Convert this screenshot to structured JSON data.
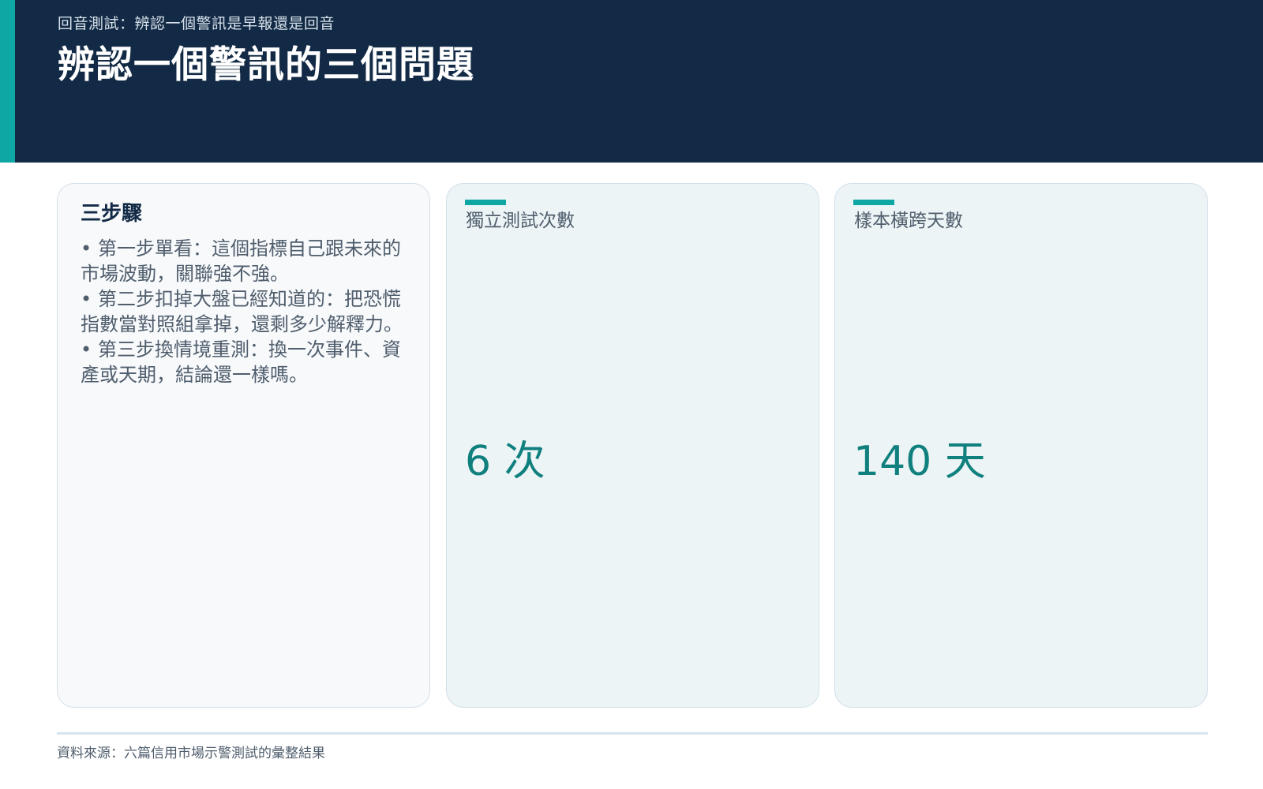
{
  "header": {
    "kicker": "回音測試：辨認一個警訊是早報還是回音",
    "title": "辨認一個警訊的三個問題"
  },
  "steps_card": {
    "title": "三步驟",
    "items": [
      "第一步單看：這個指標自己跟未來的市場波動，關聯強不強。",
      "第二步扣掉大盤已經知道的：把恐慌指數當對照組拿掉，還剩多少解釋力。",
      "第三步換情境重測：換一次事件、資產或天期，結論還一樣嗎。"
    ]
  },
  "metrics": [
    {
      "label": "獨立測試次數",
      "value": "6 次"
    },
    {
      "label": "樣本橫跨天數",
      "value": "140 天"
    }
  ],
  "footer": {
    "source": "資料來源：六篇信用市場示警測試的彙整結果"
  },
  "colors": {
    "header_bg": "#122a45",
    "accent": "#0fa7a4",
    "metric_value": "#10807e"
  }
}
